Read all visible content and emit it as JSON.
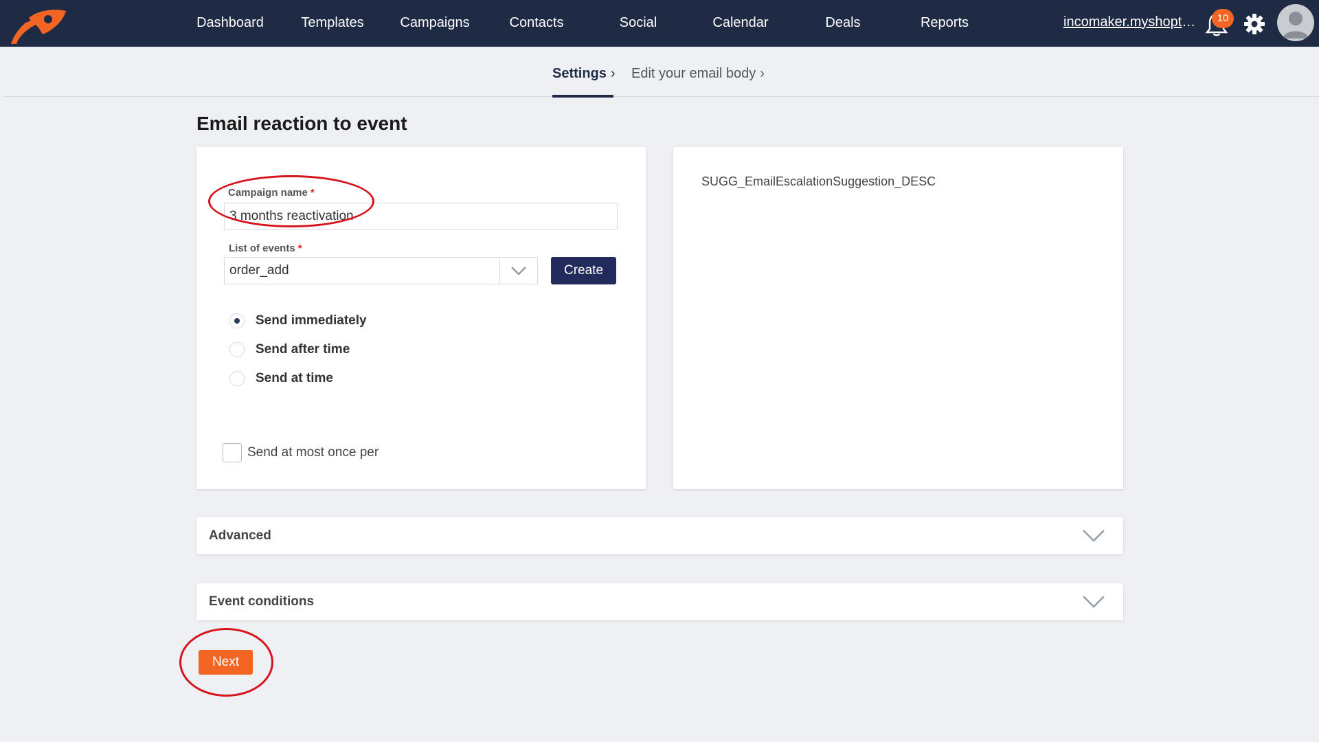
{
  "nav": {
    "items": [
      "Dashboard",
      "Templates",
      "Campaigns",
      "Contacts",
      "Social",
      "Calendar",
      "Deals",
      "Reports"
    ],
    "shop_link": "incomaker.myshopte...",
    "notification_count": "10",
    "icons": {
      "logo": "rocket-logo-icon",
      "bell": "bell-icon",
      "settings": "gear-icon",
      "avatar": "user-avatar-icon"
    },
    "accent_color": "#f26522",
    "bar_color": "#1f2b45"
  },
  "steps": {
    "settings": "Settings",
    "email_body": "Edit your email body"
  },
  "page": {
    "title": "Email reaction to event"
  },
  "form": {
    "campaign_name_label": "Campaign name",
    "campaign_name_value": "3 months reactivation",
    "required_mark": "*",
    "events_label": "List of events",
    "events_value": "order_add",
    "create_button": "Create",
    "send_options": [
      {
        "label": "Send immediately",
        "checked": true
      },
      {
        "label": "Send after time",
        "checked": false
      },
      {
        "label": "Send at time",
        "checked": false
      }
    ],
    "send_once_label": "Send at most once per",
    "send_once_checked": false
  },
  "suggestion": {
    "text": "SUGG_EmailEscalationSuggestion_DESC"
  },
  "sections": {
    "advanced": "Advanced",
    "event_conditions": "Event conditions"
  },
  "actions": {
    "next_button": "Next"
  },
  "annotation_color": "#d7141b"
}
